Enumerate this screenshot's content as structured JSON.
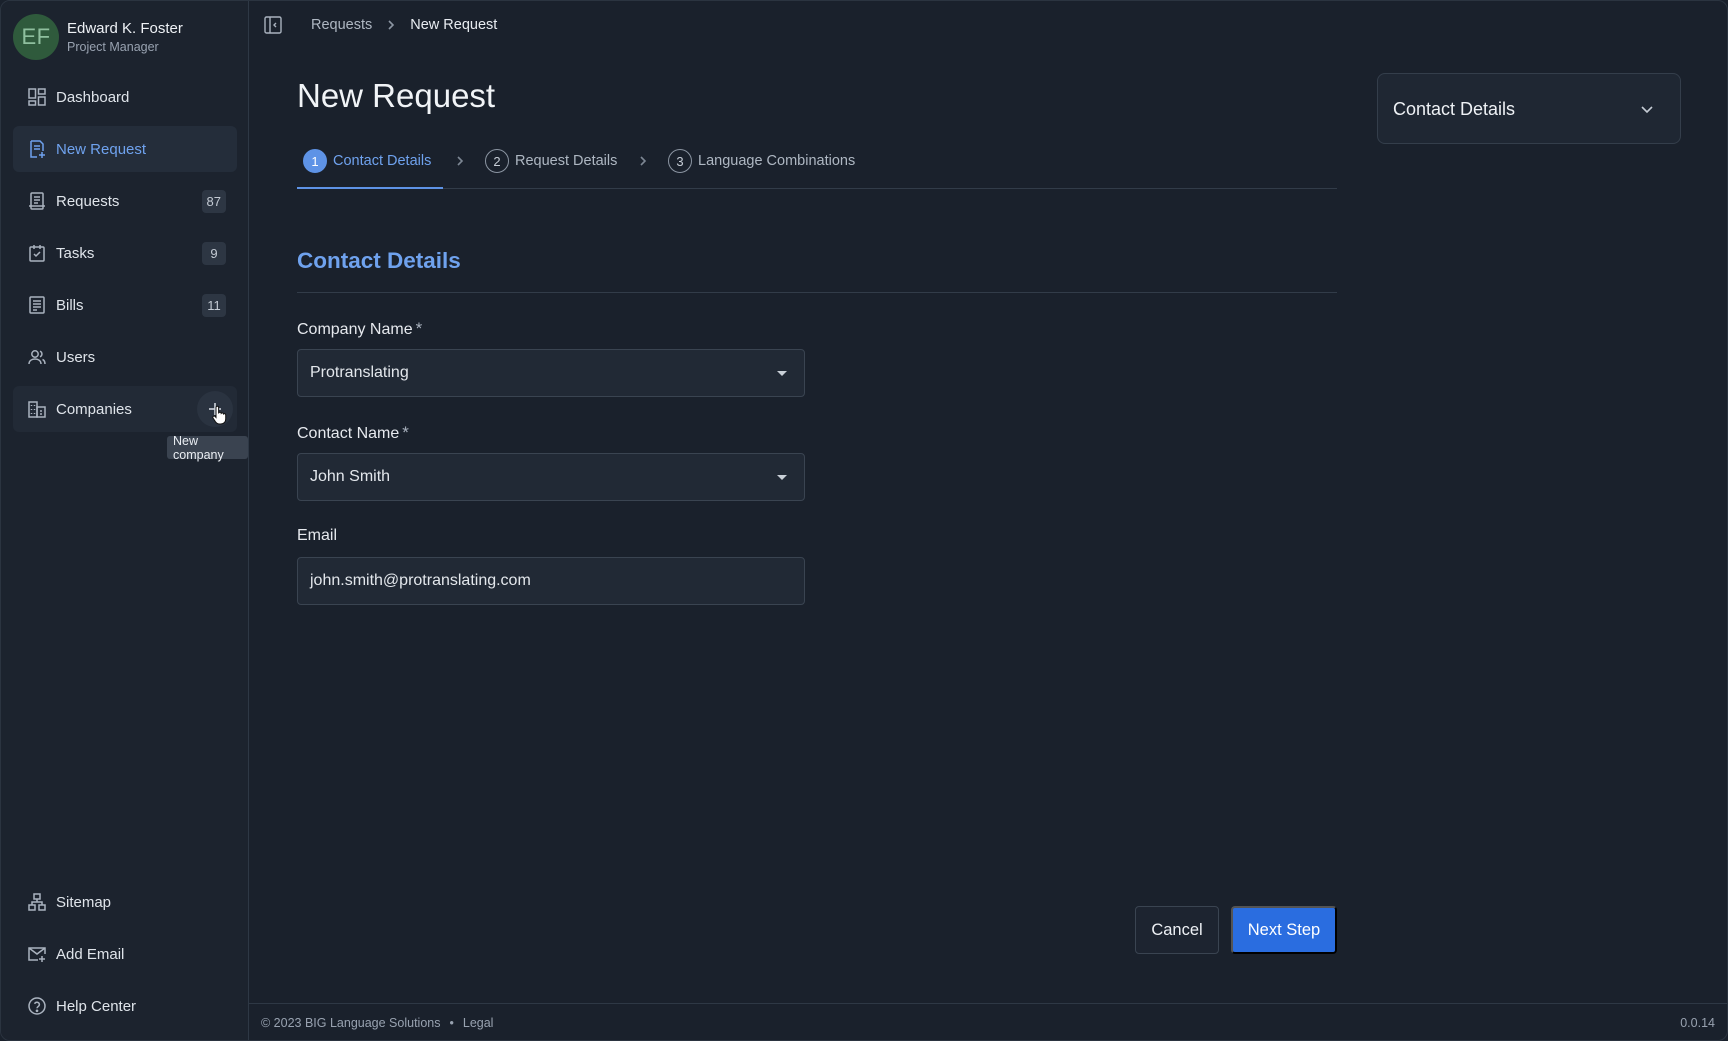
{
  "user": {
    "initials": "EF",
    "name": "Edward K. Foster",
    "role": "Project Manager"
  },
  "sidebar": {
    "items": [
      {
        "label": "Dashboard",
        "icon": "dashboard-icon"
      },
      {
        "label": "New Request",
        "icon": "new-request-icon",
        "active": true
      },
      {
        "label": "Requests",
        "icon": "requests-icon",
        "badge": "87"
      },
      {
        "label": "Tasks",
        "icon": "tasks-icon",
        "badge": "9"
      },
      {
        "label": "Bills",
        "icon": "bills-icon",
        "badge": "11"
      },
      {
        "label": "Users",
        "icon": "users-icon"
      },
      {
        "label": "Companies",
        "icon": "companies-icon"
      }
    ],
    "bottom_items": [
      {
        "label": "Sitemap",
        "icon": "sitemap-icon"
      },
      {
        "label": "Add Email",
        "icon": "add-email-icon"
      },
      {
        "label": "Help Center",
        "icon": "help-icon"
      }
    ],
    "tooltip": "New company"
  },
  "breadcrumb": {
    "parent": "Requests",
    "current": "New Request"
  },
  "page": {
    "title": "New Request"
  },
  "steps": [
    {
      "num": "1",
      "label": "Contact Details",
      "active": true
    },
    {
      "num": "2",
      "label": "Request Details"
    },
    {
      "num": "3",
      "label": "Language Combinations"
    }
  ],
  "form": {
    "section_title": "Contact Details",
    "company": {
      "label": "Company Name",
      "required": "*",
      "value": "Protranslating"
    },
    "contact": {
      "label": "Contact Name",
      "required": "*",
      "value": "John Smith"
    },
    "email": {
      "label": "Email",
      "value": "john.smith@protranslating.com"
    }
  },
  "buttons": {
    "cancel": "Cancel",
    "next": "Next Step"
  },
  "side_panel": {
    "title": "Contact Details"
  },
  "footer": {
    "copyright": "© 2023 BIG Language Solutions",
    "separator": "•",
    "legal": "Legal",
    "version": "0.0.14"
  },
  "colors": {
    "accent": "#6fa2ee",
    "primary_button": "#2a6de0",
    "background": "#1a212c"
  }
}
